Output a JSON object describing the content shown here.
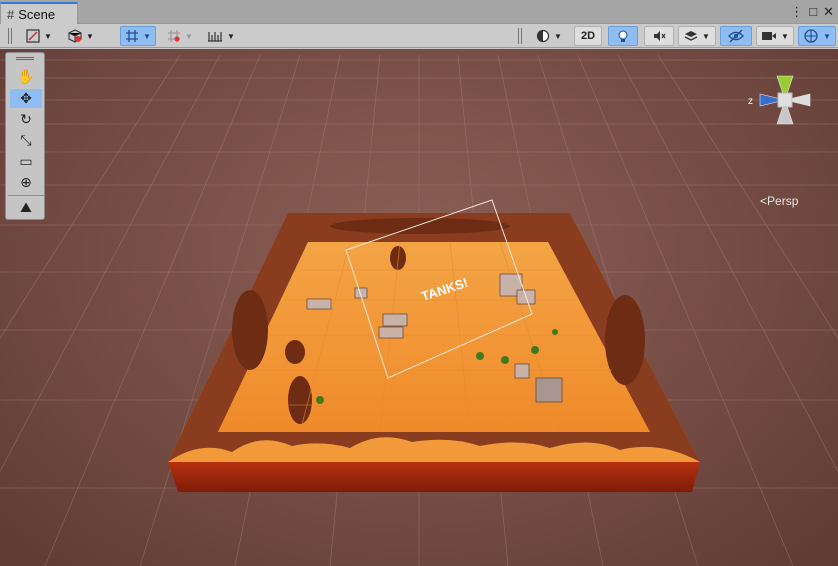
{
  "window": {
    "tab_title": "Scene",
    "tab_icon": "grid-hash-icon",
    "window_buttons": [
      "kebab-menu-icon",
      "maximize-icon",
      "close-icon"
    ]
  },
  "toolbar": {
    "shading_icon": "draw-mode-icon",
    "render_icon": "render-cube-icon",
    "grid_snap_icon": "grid-snap-icon",
    "incremental_snap_icon": "incremental-snap-icon",
    "ruler_icon": "ruler-icon",
    "orientation_icon": "sphere-shading-icon",
    "mode_2d_label": "2D",
    "lighting_icon": "lightbulb-icon",
    "audio_icon": "audio-mute-icon",
    "effects_icon": "layers-effects-icon",
    "visibility_icon": "scene-visibility-icon",
    "camera_icon": "camera-icon",
    "gizmos_icon": "gizmos-icon"
  },
  "tools": [
    "hand-tool-icon",
    "move-tool-icon",
    "rotate-tool-icon",
    "scale-tool-icon",
    "rect-tool-icon",
    "transform-tool-icon",
    "custom-tool-icon"
  ],
  "viewport": {
    "world_label": "TANKS!",
    "projection_label": "Persp",
    "axis_z_label": "z",
    "colors": {
      "background": "#754c44",
      "sand": "#f0a040",
      "cliff": "#7a3a20",
      "base": "#a42a0c",
      "grid_active": "#3f86d8"
    }
  }
}
